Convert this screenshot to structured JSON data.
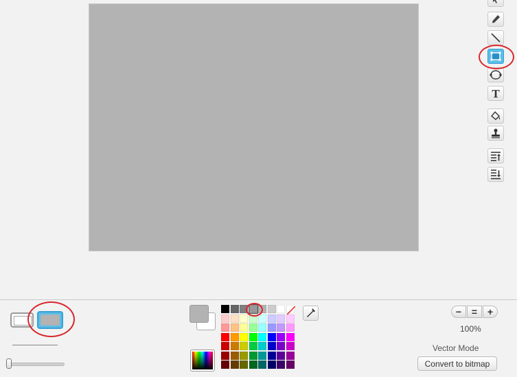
{
  "toolbar": {
    "tools": [
      {
        "name": "select"
      },
      {
        "name": "paintbrush"
      },
      {
        "name": "line"
      },
      {
        "name": "rectangle",
        "selected": true
      },
      {
        "name": "ellipse"
      },
      {
        "name": "text",
        "glyph": "T"
      },
      {
        "name": "fill"
      },
      {
        "name": "stamp"
      },
      {
        "name": "forward-a-layer"
      },
      {
        "name": "back-a-layer"
      }
    ]
  },
  "canvas": {
    "fill_color": "#b3b3b3"
  },
  "shape_fill": {
    "options": [
      "outlined",
      "filled"
    ],
    "selected": "filled"
  },
  "line_width": {
    "value": 0
  },
  "colors": {
    "primary": "#b3b3b3",
    "secondary": "#ffffff",
    "selected_palette_color": "#999999",
    "palette": [
      "#000000",
      "#666666",
      "#808080",
      "#999999",
      "#b3b3b3",
      "#cccccc",
      "#ffffff",
      "transparent",
      "#ffcccc",
      "#ffe0c2",
      "#ffffcc",
      "#ccffcc",
      "#ccffff",
      "#ccccff",
      "#e0ccff",
      "#ffccff",
      "#ff9999",
      "#ffc285",
      "#ffff99",
      "#99ff99",
      "#99ffff",
      "#9999ff",
      "#c299ff",
      "#ff99ff",
      "#ff0000",
      "#ff9900",
      "#ffff00",
      "#00ff00",
      "#00ffff",
      "#0000ff",
      "#9900ff",
      "#ff00ff",
      "#cc0000",
      "#cc7a00",
      "#cccc00",
      "#00cc44",
      "#00cccc",
      "#0000cc",
      "#7a00cc",
      "#cc00cc",
      "#990000",
      "#995c00",
      "#999900",
      "#009933",
      "#009999",
      "#000099",
      "#5c0099",
      "#990099",
      "#660000",
      "#663d00",
      "#666600",
      "#006622",
      "#006666",
      "#000066",
      "#3d0066",
      "#660066"
    ]
  },
  "zoom": {
    "level": "100%",
    "out_glyph": "−",
    "reset_glyph": "=",
    "in_glyph": "+"
  },
  "mode": {
    "label": "Vector Mode",
    "convert_label": "Convert to bitmap"
  }
}
